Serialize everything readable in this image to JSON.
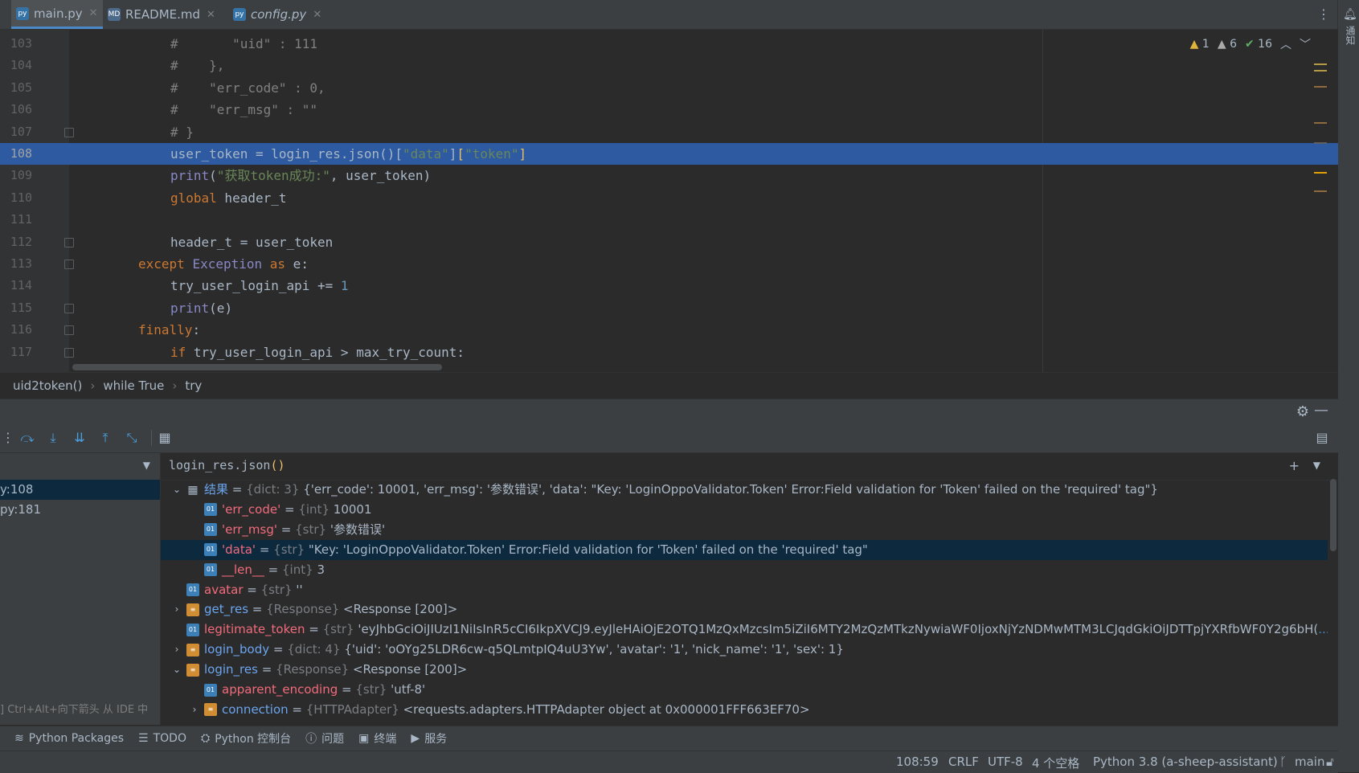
{
  "tabs": [
    {
      "label": "main.py",
      "icon": "python-file-icon",
      "active": true
    },
    {
      "label": "README.md",
      "icon": "markdown-file-icon",
      "active": false
    },
    {
      "label": "config.py",
      "icon": "python-file-icon",
      "active": false
    }
  ],
  "inspections": {
    "warn1": "1",
    "warn2": "6",
    "ok": "16"
  },
  "editor": {
    "lines": [
      {
        "num": "103",
        "code": [
          [
            "cm",
            "#       \"uid\" : 111"
          ]
        ]
      },
      {
        "num": "104",
        "code": [
          [
            "cm",
            "#    },"
          ]
        ]
      },
      {
        "num": "105",
        "code": [
          [
            "cm",
            "#    \"err_code\" : 0,"
          ]
        ]
      },
      {
        "num": "106",
        "code": [
          [
            "cm",
            "#    \"err_msg\" : \"\""
          ]
        ]
      },
      {
        "num": "107",
        "code": [
          [
            "cm",
            "# }"
          ]
        ]
      },
      {
        "num": "108",
        "code": [
          [
            "",
            "user_token = login_res.json()["
          ],
          [
            "str",
            "\"data\""
          ],
          [
            "",
            "]"
          ],
          [
            "br",
            "["
          ],
          [
            "str",
            "\"token\""
          ],
          [
            "br",
            "]"
          ]
        ],
        "highlight": true
      },
      {
        "num": "109",
        "code": [
          [
            "fn",
            "print"
          ],
          [
            "",
            "("
          ],
          [
            "str",
            "\"获取token成功:\""
          ],
          [
            "",
            ", user_token)"
          ]
        ]
      },
      {
        "num": "110",
        "code": [
          [
            "kw",
            "global"
          ],
          [
            "",
            " header_t"
          ]
        ]
      },
      {
        "num": "111",
        "code": []
      },
      {
        "num": "112",
        "code": [
          [
            "",
            "header_t = user_token"
          ]
        ]
      },
      {
        "num": "113",
        "code": [
          [
            "kw",
            "except"
          ],
          [
            "",
            " "
          ],
          [
            "fn",
            "Exception"
          ],
          [
            "kw",
            " as"
          ],
          [
            "",
            " e:"
          ]
        ],
        "indent": "out"
      },
      {
        "num": "114",
        "code": [
          [
            "",
            "try_user_login_api += "
          ],
          [
            "num",
            "1"
          ]
        ]
      },
      {
        "num": "115",
        "code": [
          [
            "fn",
            "print"
          ],
          [
            "",
            "(e)"
          ]
        ]
      },
      {
        "num": "116",
        "code": [
          [
            "kw",
            "finally"
          ],
          [
            "",
            ":"
          ]
        ],
        "indent": "out"
      },
      {
        "num": "117",
        "code": [
          [
            "kw",
            "if"
          ],
          [
            "",
            " try_user_login_api > max_try_count:"
          ]
        ]
      }
    ]
  },
  "breadcrumb": [
    "uid2token()",
    "while True",
    "try"
  ],
  "frames": [
    {
      "label": "y:108",
      "selected": true
    },
    {
      "label": "py:181",
      "selected": false
    }
  ],
  "frames_hint": "] Ctrl+Alt+向下箭头 从 IDE 中",
  "expression": {
    "text": "login_res.json",
    "paren": "()"
  },
  "vars": [
    {
      "level": 0,
      "arrow": "down",
      "icon": "dict",
      "name": "结果",
      "nameColor": "blue",
      "type": "{dict: 3}",
      "value": "{'err_code': 10001, 'err_msg': '参数错误', 'data': \"Key: 'LoginOppoValidator.Token' Error:Field validation for 'Token' failed on the 'required' tag\"}"
    },
    {
      "level": 1,
      "arrow": "",
      "icon": "o1",
      "name": "'err_code'",
      "nameColor": "red",
      "type": "{int}",
      "value": "10001"
    },
    {
      "level": 1,
      "arrow": "",
      "icon": "o1",
      "name": "'err_msg'",
      "nameColor": "red",
      "type": "{str}",
      "value": "'参数错误'"
    },
    {
      "level": 1,
      "arrow": "",
      "icon": "o1",
      "name": "'data'",
      "nameColor": "red",
      "type": "{str}",
      "value": "\"Key: 'LoginOppoValidator.Token' Error:Field validation for 'Token' failed on the 'required' tag\"",
      "selected": true
    },
    {
      "level": 1,
      "arrow": "",
      "icon": "o1",
      "name": "__len__",
      "nameColor": "red",
      "type": "{int}",
      "value": "3"
    },
    {
      "level": 0,
      "arrow": "",
      "icon": "o1",
      "name": "avatar",
      "nameColor": "red",
      "type": "{str}",
      "value": "''"
    },
    {
      "level": 0,
      "arrow": "right",
      "icon": "obj",
      "name": "get_res",
      "nameColor": "blue",
      "type": "{Response}",
      "value": "<Response [200]>"
    },
    {
      "level": 0,
      "arrow": "",
      "icon": "o1",
      "name": "legitimate_token",
      "nameColor": "red",
      "type": "{str}",
      "value": "'eyJhbGciOiJIUzI1NiIsInR5cCI6IkpXVCJ9.eyJleHAiOjE2OTQ1MzQxMzcsIm5iZiI6MTY2MzQzMTkzNywiaWF0IjoxNjYzNDMwMTM3LCJqdGkiOiJDTTpjYXRfbWF0Y2g6bH(",
      "link": "...视图"
    },
    {
      "level": 0,
      "arrow": "right",
      "icon": "obj",
      "name": "login_body",
      "nameColor": "blue",
      "type": "{dict: 4}",
      "value": "{'uid': 'oOYg25LDR6cw-q5QLmtpIQ4uU3Yw', 'avatar': '1', 'nick_name': '1', 'sex': 1}"
    },
    {
      "level": 0,
      "arrow": "down",
      "icon": "obj",
      "name": "login_res",
      "nameColor": "blue",
      "type": "{Response}",
      "value": "<Response [200]>"
    },
    {
      "level": 1,
      "arrow": "",
      "icon": "o1",
      "name": "apparent_encoding",
      "nameColor": "red",
      "type": "{str}",
      "value": "'utf-8'"
    },
    {
      "level": 1,
      "arrow": "right",
      "icon": "obj",
      "name": "connection",
      "nameColor": "blue",
      "type": "{HTTPAdapter}",
      "value": "<requests.adapters.HTTPAdapter object at 0x000001FFF663EF70>"
    }
  ],
  "tooltabs": [
    {
      "label": "Python Packages",
      "icon": "packages-icon"
    },
    {
      "label": "TODO",
      "icon": "todo-icon"
    },
    {
      "label": "Python 控制台",
      "icon": "python-console-icon"
    },
    {
      "label": "问题",
      "icon": "problems-icon"
    },
    {
      "label": "终端",
      "icon": "terminal-icon"
    },
    {
      "label": "服务",
      "icon": "services-icon"
    }
  ],
  "status": {
    "position": "108:59",
    "line_sep": "CRLF",
    "encoding": "UTF-8",
    "indent": "4 个空格",
    "interpreter": "Python 3.8 (a-sheep-assistant)",
    "branch": "main"
  },
  "notifications_label": "通知",
  "colors": {
    "accent": "#4a88c7",
    "selection": "#2d5aa0",
    "background": "#2b2b2b"
  }
}
